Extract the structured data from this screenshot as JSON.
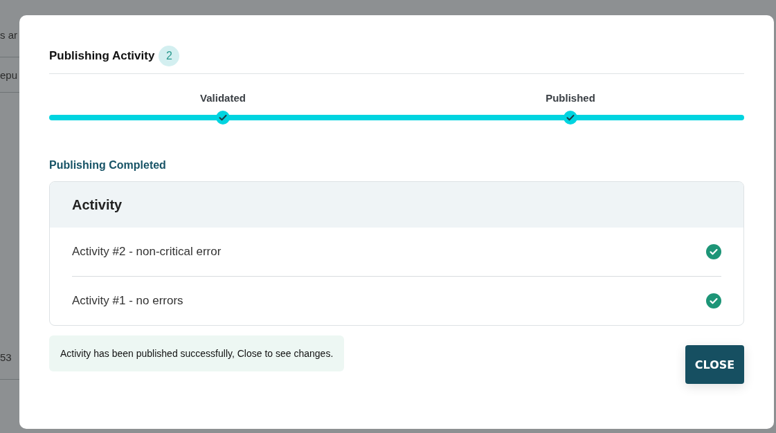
{
  "background": {
    "fragments": [
      "s ar",
      "epu",
      "53"
    ]
  },
  "dialog": {
    "title": "Publishing Activity",
    "count": "2",
    "steps": [
      {
        "label": "Validated",
        "completed": true
      },
      {
        "label": "Published",
        "completed": true
      }
    ],
    "status_heading": "Publishing Completed",
    "table": {
      "header": "Activity",
      "rows": [
        {
          "text": "Activity #2 - non-critical error",
          "succeeded": true
        },
        {
          "text": "Activity #1 - no errors",
          "succeeded": true
        }
      ]
    },
    "message": "Activity has been published successfully, Close to see changes.",
    "buttons": [
      "CLOSE"
    ]
  }
}
